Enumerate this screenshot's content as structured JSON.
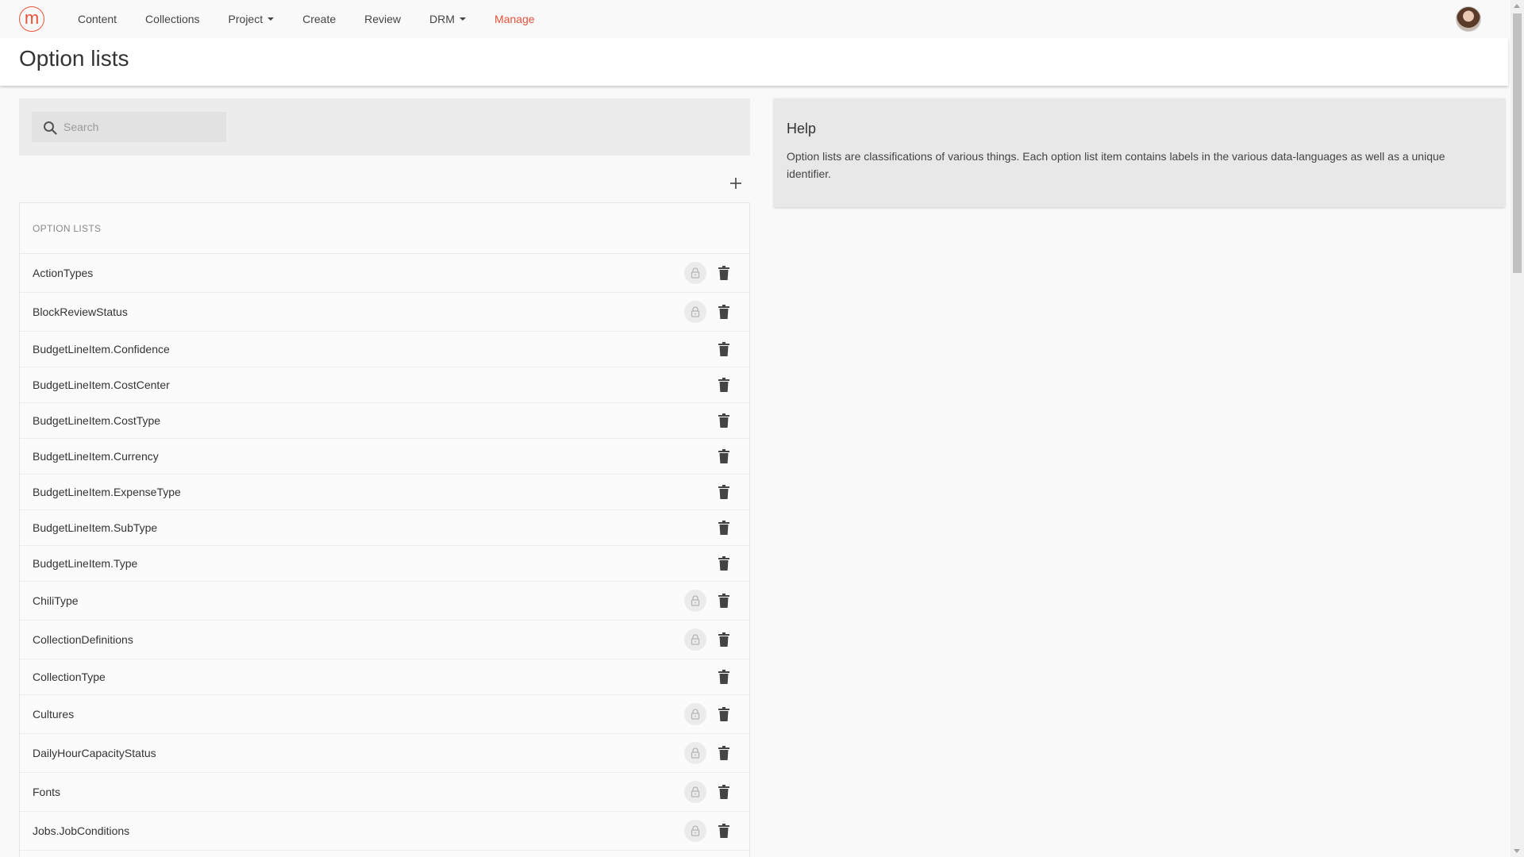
{
  "nav": {
    "logo_letter": "m",
    "items": [
      {
        "label": "Content",
        "dropdown": false,
        "active": false
      },
      {
        "label": "Collections",
        "dropdown": false,
        "active": false
      },
      {
        "label": "Project",
        "dropdown": true,
        "active": false
      },
      {
        "label": "Create",
        "dropdown": false,
        "active": false
      },
      {
        "label": "Review",
        "dropdown": false,
        "active": false
      },
      {
        "label": "DRM",
        "dropdown": true,
        "active": false
      },
      {
        "label": "Manage",
        "dropdown": false,
        "active": true
      }
    ],
    "accent_color": "#e8523a"
  },
  "page": {
    "title": "Option lists"
  },
  "search": {
    "placeholder": "Search",
    "value": ""
  },
  "list": {
    "header": "OPTION LISTS",
    "rows": [
      {
        "name": "ActionTypes",
        "locked": true
      },
      {
        "name": "BlockReviewStatus",
        "locked": true
      },
      {
        "name": "BudgetLineItem.Confidence",
        "locked": false
      },
      {
        "name": "BudgetLineItem.CostCenter",
        "locked": false
      },
      {
        "name": "BudgetLineItem.CostType",
        "locked": false
      },
      {
        "name": "BudgetLineItem.Currency",
        "locked": false
      },
      {
        "name": "BudgetLineItem.ExpenseType",
        "locked": false
      },
      {
        "name": "BudgetLineItem.SubType",
        "locked": false
      },
      {
        "name": "BudgetLineItem.Type",
        "locked": false
      },
      {
        "name": "ChiliType",
        "locked": true
      },
      {
        "name": "CollectionDefinitions",
        "locked": true
      },
      {
        "name": "CollectionType",
        "locked": false
      },
      {
        "name": "Cultures",
        "locked": true
      },
      {
        "name": "DailyHourCapacityStatus",
        "locked": true
      },
      {
        "name": "Fonts",
        "locked": true
      },
      {
        "name": "Jobs.JobConditions",
        "locked": true
      },
      {
        "name": "",
        "locked": true
      }
    ]
  },
  "help": {
    "title": "Help",
    "text": "Option lists are classifications of various things. Each option list item contains labels in the various data-languages as well as a unique identifier."
  }
}
